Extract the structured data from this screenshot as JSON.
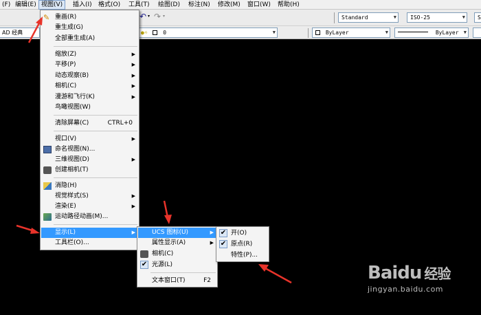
{
  "menubar": {
    "items": [
      "(F)",
      "编辑(E)",
      "视图(V)",
      "插入(I)",
      "格式(O)",
      "工具(T)",
      "绘图(D)",
      "标注(N)",
      "修改(M)",
      "窗口(W)",
      "帮助(H)"
    ]
  },
  "toolbar": {
    "text_style": "Standard",
    "dim_style": "ISO-25",
    "right_partial": "S",
    "workspace": "AD 经典",
    "layer": "0",
    "color": "ByLayer",
    "linetype": "ByLayer"
  },
  "view_menu": {
    "items": [
      {
        "label": "重画(R)",
        "icon": "pencil-icon"
      },
      {
        "label": "重生成(G)"
      },
      {
        "label": "全部重生成(A)"
      },
      {
        "label": "缩放(Z)",
        "submenu": true
      },
      {
        "label": "平移(P)",
        "submenu": true
      },
      {
        "label": "动态观察(B)",
        "submenu": true
      },
      {
        "label": "相机(C)",
        "submenu": true
      },
      {
        "label": "漫游和飞行(K)",
        "submenu": true
      },
      {
        "label": "鸟瞰视图(W)"
      },
      {
        "label": "清除屏幕(C)",
        "shortcut": "CTRL+0"
      },
      {
        "label": "视口(V)",
        "submenu": true
      },
      {
        "label": "命名视图(N)...",
        "icon": "named-view-icon"
      },
      {
        "label": "三维视图(D)",
        "submenu": true
      },
      {
        "label": "创建相机(T)",
        "icon": "camera-icon"
      },
      {
        "label": "消隐(H)",
        "icon": "hide-icon"
      },
      {
        "label": "视觉样式(S)",
        "submenu": true
      },
      {
        "label": "渲染(E)",
        "submenu": true
      },
      {
        "label": "运动路径动画(M)...",
        "icon": "motion-path-icon"
      },
      {
        "label": "显示(L)",
        "submenu": true,
        "highlighted": true
      },
      {
        "label": "工具栏(O)..."
      }
    ]
  },
  "display_menu": {
    "items": [
      {
        "label": "UCS 图标(U)",
        "submenu": true,
        "highlighted": true
      },
      {
        "label": "属性显示(A)",
        "submenu": true
      },
      {
        "label": "相机(C)",
        "icon": "camera-icon"
      },
      {
        "label": "光源(L)",
        "checked": true
      },
      {
        "label": "文本窗口(T)",
        "shortcut": "F2"
      }
    ]
  },
  "ucs_menu": {
    "items": [
      {
        "label": "开(O)",
        "checked": true
      },
      {
        "label": "原点(R)",
        "checked": true
      },
      {
        "label": "特性(P)..."
      }
    ]
  },
  "watermark": {
    "brand": "Baidu",
    "brand_zh": "经验",
    "url": "jingyan.baidu.com"
  },
  "colors": {
    "highlight": "#3399ff",
    "annotation_arrow": "#e8332a",
    "canvas": "#000000"
  }
}
